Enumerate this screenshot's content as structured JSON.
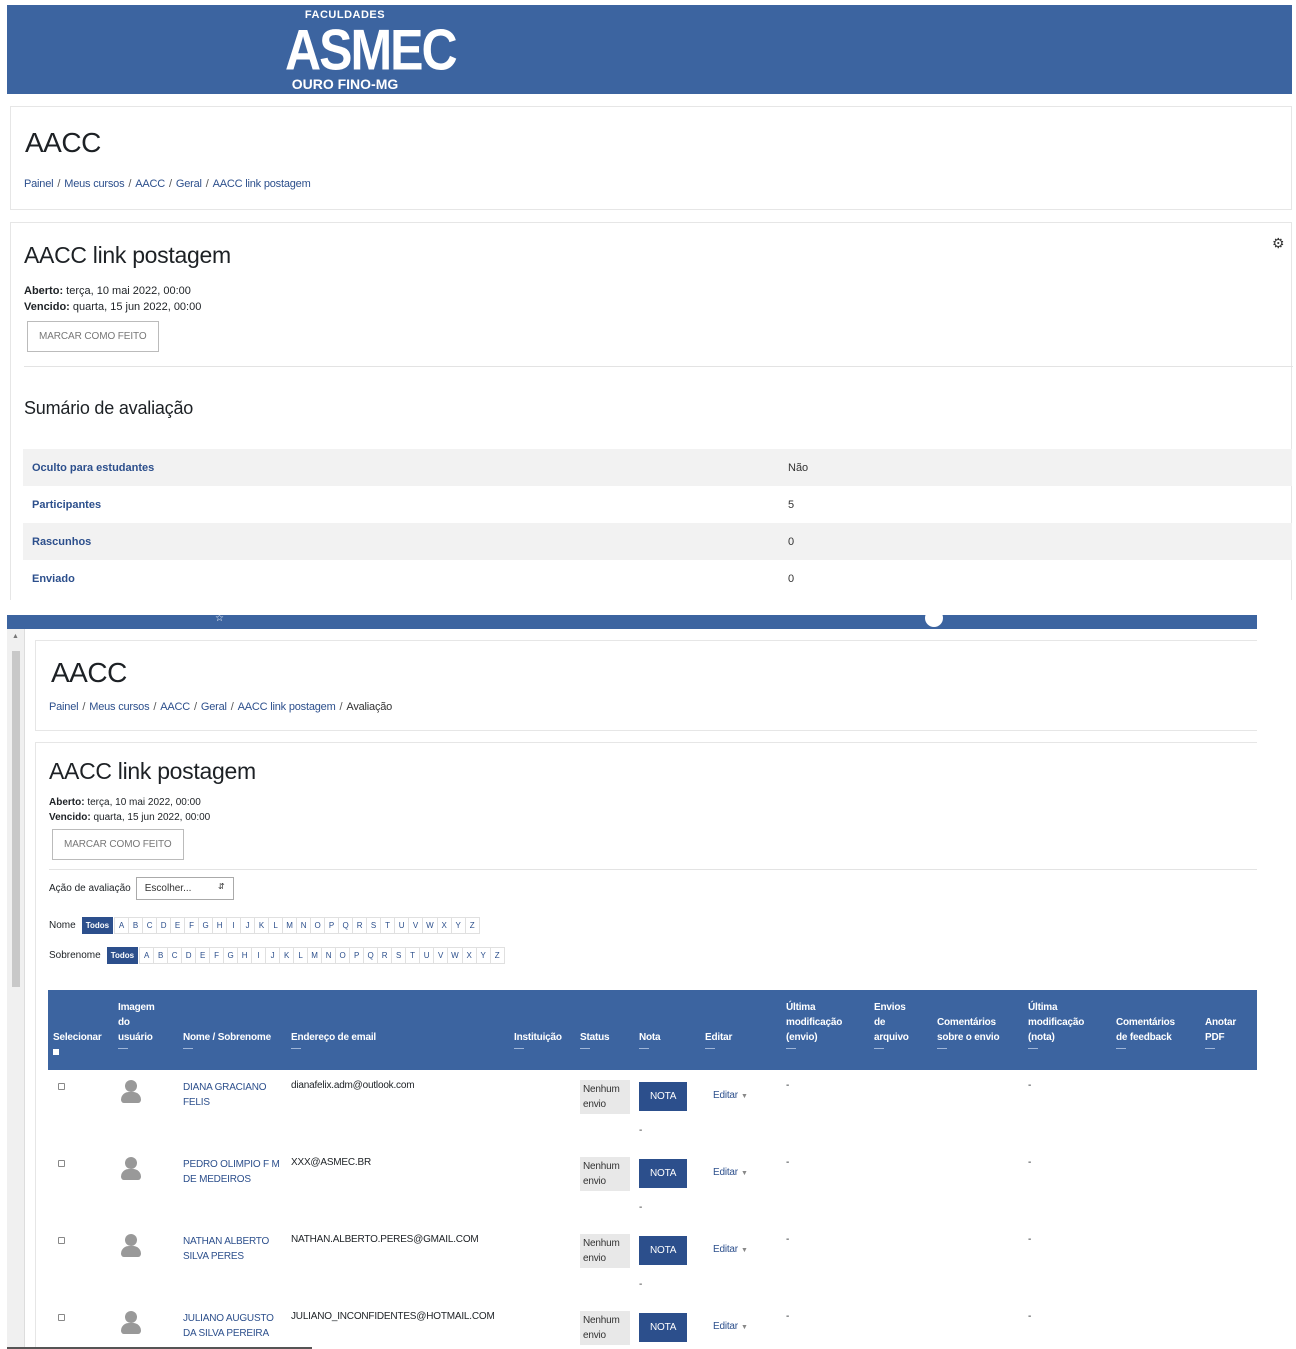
{
  "logo": {
    "line1": "FACULDADES",
    "line2": "ASMEC",
    "line3": "OURO FINO-MG"
  },
  "top": {
    "course_title": "AACC",
    "breadcrumb": [
      "Painel",
      "Meus cursos",
      "AACC",
      "Geral",
      "AACC link postagem"
    ],
    "activity_title": "AACC link postagem",
    "opened_label": "Aberto:",
    "opened_value": "terça, 10 mai 2022, 00:00",
    "due_label": "Vencido:",
    "due_value": "quarta, 15 jun 2022, 00:00",
    "mark_done": "MARCAR COMO FEITO",
    "summary_title": "Sumário de avaliação",
    "summary": [
      {
        "key": "Oculto para estudantes",
        "value": "Não"
      },
      {
        "key": "Participantes",
        "value": "5"
      },
      {
        "key": "Rascunhos",
        "value": "0"
      },
      {
        "key": "Enviado",
        "value": "0"
      }
    ]
  },
  "bottom": {
    "course_title": "AACC",
    "breadcrumb": [
      "Painel",
      "Meus cursos",
      "AACC",
      "Geral",
      "AACC link postagem",
      "Avaliação"
    ],
    "activity_title": "AACC link postagem",
    "opened_label": "Aberto:",
    "opened_value": "terça, 10 mai 2022, 00:00",
    "due_label": "Vencido:",
    "due_value": "quarta, 15 jun 2022, 00:00",
    "mark_done": "MARCAR COMO FEITO",
    "grading_action_label": "Ação de avaliação",
    "grading_action_value": "Escolher...",
    "first_name_label": "Nome",
    "last_name_label": "Sobrenome",
    "all_label": "Todos",
    "letters": [
      "A",
      "B",
      "C",
      "D",
      "E",
      "F",
      "G",
      "H",
      "I",
      "J",
      "K",
      "L",
      "M",
      "N",
      "O",
      "P",
      "Q",
      "R",
      "S",
      "T",
      "U",
      "V",
      "W",
      "X",
      "Y",
      "Z"
    ],
    "columns": {
      "select": "Selecionar",
      "image": "Imagem do usuário",
      "name": "Nome / Sobrenome",
      "email": "Endereço de email",
      "institution": "Instituição",
      "status": "Status",
      "grade": "Nota",
      "edit": "Editar",
      "last_mod_sub": "Última modificação (envio)",
      "file_subs": "Envios de arquivo",
      "sub_comments": "Comentários sobre o envio",
      "last_mod_grade": "Última modificação (nota)",
      "feedback_comments": "Comentários de feedback",
      "annotate_pdf": "Anotar PDF"
    },
    "header_dash": "—",
    "rows": [
      {
        "name": "DIANA GRACIANO FELIS",
        "email": "dianafelix.adm@outlook.com",
        "status": "Nenhum envio",
        "grade_btn": "NOTA",
        "grade_dash": "-",
        "edit": "Editar",
        "last_mod_sub": "-",
        "last_mod_grade": "-"
      },
      {
        "name": "PEDRO OLIMPIO F M DE MEDEIROS",
        "email": "XXX@ASMEC.BR",
        "status": "Nenhum envio",
        "grade_btn": "NOTA",
        "grade_dash": "-",
        "edit": "Editar",
        "last_mod_sub": "-",
        "last_mod_grade": "-"
      },
      {
        "name": "NATHAN ALBERTO SILVA PERES",
        "email": "NATHAN.ALBERTO.PERES@GMAIL.COM",
        "status": "Nenhum envio",
        "grade_btn": "NOTA",
        "grade_dash": "-",
        "edit": "Editar",
        "last_mod_sub": "-",
        "last_mod_grade": "-"
      },
      {
        "name": "JULIANO AUGUSTO DA SILVA PEREIRA",
        "email": "JULIANO_INCONFIDENTES@HOTMAIL.COM",
        "status": "Nenhum envio",
        "grade_btn": "NOTA",
        "grade_dash": "-",
        "edit": "Editar",
        "last_mod_sub": "-",
        "last_mod_grade": "-"
      }
    ]
  }
}
